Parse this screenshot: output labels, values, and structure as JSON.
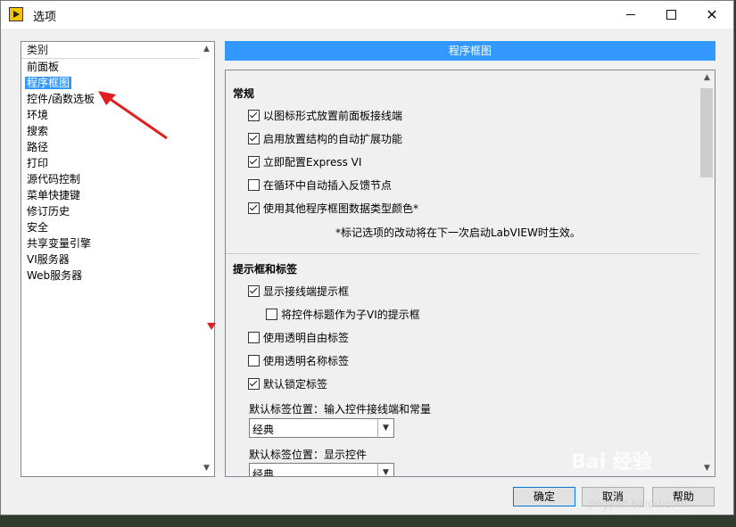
{
  "window": {
    "title": "选项",
    "minimize_glyph": "",
    "maximize_glyph": "",
    "close_glyph": "✕"
  },
  "categories": {
    "header": "类别",
    "items": [
      "前面板",
      "程序框图",
      "控件/函数选板",
      "环境",
      "搜索",
      "路径",
      "打印",
      "源代码控制",
      "菜单快捷键",
      "修订历史",
      "安全",
      "共享变量引擎",
      "VI服务器",
      "Web服务器"
    ],
    "selected": "程序框图"
  },
  "section_header": "程序框图",
  "general": {
    "title": "常规",
    "options": [
      {
        "label": "以图标形式放置前面板接线端",
        "checked": true
      },
      {
        "label": "启用放置结构的自动扩展功能",
        "checked": true
      },
      {
        "label": "立即配置Express VI",
        "checked": true
      },
      {
        "label": "在循环中自动插入反馈节点",
        "checked": false
      },
      {
        "label": "使用其他程序框图数据类型颜色*",
        "checked": true
      }
    ],
    "note": "*标记选项的改动将在下一次启动LabVIEW时生效。"
  },
  "tips": {
    "title": "提示框和标签",
    "options": [
      {
        "label": "显示接线端提示框",
        "checked": true
      },
      {
        "label": "将控件标题作为子VI的提示框",
        "checked": false
      },
      {
        "label": "使用透明自由标签",
        "checked": false
      },
      {
        "label": "使用透明名称标签",
        "checked": false
      },
      {
        "label": "默认锁定标签",
        "checked": true
      }
    ],
    "label_pos_input": {
      "label": "默认标签位置：输入控件接线端和常量",
      "value": "经典"
    },
    "label_pos_display": {
      "label": "默认标签位置：显示控件",
      "value": "经典"
    }
  },
  "buttons": {
    "ok": "确定",
    "cancel": "取消",
    "help": "帮助"
  },
  "watermark": {
    "text": "Bai 经验",
    "url": "jingyan.baidu.com"
  },
  "colors": {
    "accent": "#3399ff",
    "annotation": "#e02020"
  }
}
